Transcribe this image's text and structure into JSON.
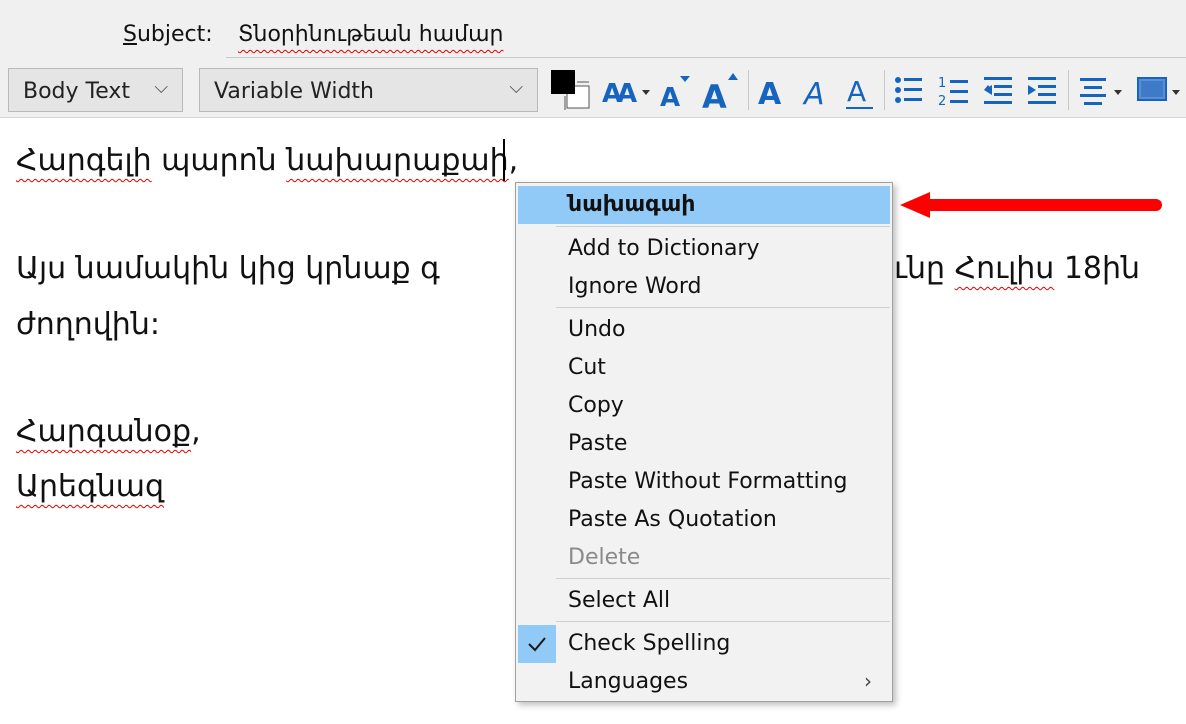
{
  "subject": {
    "label": "Subject:",
    "label_underline": "S",
    "label_rest": "ubject:",
    "value": "Տնօրինութեան համար"
  },
  "toolbar": {
    "paragraph_style": "Body Text",
    "font": "Variable Width",
    "icons": [
      "text-color-icon",
      "font-size-menu-icon",
      "decrease-font-icon",
      "increase-font-icon",
      "bold-icon",
      "italic-icon",
      "underline-icon",
      "bullet-list-icon",
      "numbered-list-icon",
      "outdent-icon",
      "indent-icon",
      "align-menu-icon",
      "insert-menu-icon"
    ]
  },
  "editor": {
    "line1": {
      "w1": "Հարգելի",
      "w2": "պարոն",
      "w3": "նախարաքաի",
      "punct": ","
    },
    "line2": {
      "left": "Այս նամակին կից կրնաք գ",
      "right_a": "ւնը ",
      "right_b": "Հուլիս",
      "right_c": " 18ին"
    },
    "line3": "ժողովին:",
    "line4": {
      "word": "Հարգանօք",
      "punct": ","
    },
    "line5": "Արեգնազ"
  },
  "context_menu": {
    "suggestion": "նախագաի",
    "items": [
      {
        "label": "Add to Dictionary"
      },
      {
        "label": "Ignore Word"
      },
      {
        "label": "Undo"
      },
      {
        "label": "Cut"
      },
      {
        "label": "Copy"
      },
      {
        "label": "Paste"
      },
      {
        "label": "Paste Without Formatting"
      },
      {
        "label": "Paste As Quotation"
      },
      {
        "label": "Delete",
        "disabled": true
      },
      {
        "label": "Select All"
      },
      {
        "label": "Check Spelling",
        "checked": true
      },
      {
        "label": "Languages",
        "submenu": true
      }
    ]
  },
  "colors": {
    "highlight": "#91c9f7",
    "annotation_arrow": "#ff0000",
    "text_color_swatch": "#000000",
    "accent_blue": "#1565c0"
  }
}
